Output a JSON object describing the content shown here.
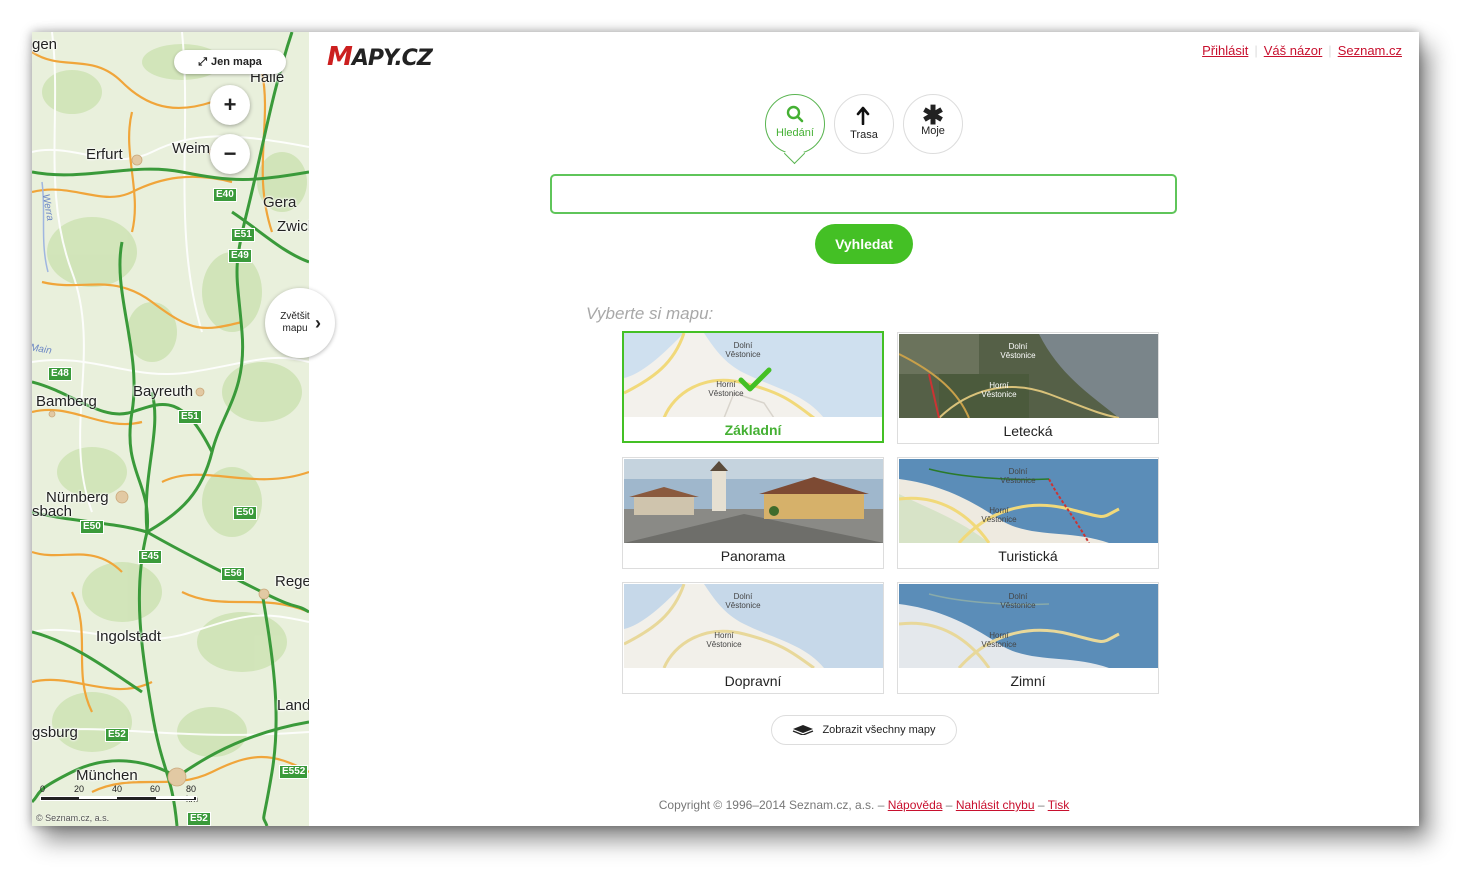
{
  "map": {
    "only_map_label": "Jen mapa",
    "zoom_in": "+",
    "zoom_out": "−",
    "expand_label_line1": "Zvětšit",
    "expand_label_line2": "mapu",
    "cities": [
      "gen",
      "Halle",
      "Erfurt",
      "Weim",
      "Gera",
      "Zwick",
      "Bamberg",
      "Bayreuth",
      "Nürnberg",
      "sbach",
      "Rege",
      "Ingolstadt",
      "Land",
      "gsburg",
      "München"
    ],
    "roads": [
      "E40",
      "E51",
      "E49",
      "E48",
      "E51",
      "E50",
      "E50",
      "E45",
      "E56",
      "E52",
      "E552",
      "E52"
    ],
    "rivers": [
      "Werra",
      "Main"
    ],
    "scale_ticks": [
      "0",
      "20",
      "40",
      "60",
      "80 km"
    ],
    "copyright": "© Seznam.cz, a.s."
  },
  "header": {
    "logo_m": "M",
    "logo_rest": "APY.CZ",
    "links": [
      "Přihlásit",
      "Váš názor",
      "Seznam.cz"
    ]
  },
  "modes": [
    {
      "label": "Hledání",
      "icon": "search-icon"
    },
    {
      "label": "Trasa",
      "icon": "arrow-up-icon"
    },
    {
      "label": "Moje",
      "icon": "star-icon"
    }
  ],
  "search": {
    "value": "",
    "button": "Vyhledat"
  },
  "choose_label": "Vyberte si mapu:",
  "map_types": [
    {
      "name": "Základní",
      "selected": true,
      "thumb_labels": [
        "Dolní Věstonice",
        "Horní Věstonice"
      ]
    },
    {
      "name": "Letecká",
      "selected": false,
      "thumb_labels": [
        "Dolní Věstonice",
        "Horní Věstonice"
      ]
    },
    {
      "name": "Panorama",
      "selected": false,
      "thumb_labels": []
    },
    {
      "name": "Turistická",
      "selected": false,
      "thumb_labels": [
        "Dolní Věstonice",
        "Horní Věstonice"
      ]
    },
    {
      "name": "Dopravní",
      "selected": false,
      "thumb_labels": [
        "Dolní Věstonice",
        "Horní Věstonice"
      ]
    },
    {
      "name": "Zimní",
      "selected": false,
      "thumb_labels": [
        "Dolní Věstonice",
        "Horní Věstonice"
      ]
    }
  ],
  "all_maps_label": "Zobrazit všechny mapy",
  "footer": {
    "copyright": "Copyright © 1996–2014 Seznam.cz, a.s. –",
    "links": [
      "Nápověda",
      "Nahlásit chybu",
      "Tisk"
    ],
    "sep": "–"
  },
  "colors": {
    "accent_green": "#44c025",
    "link_red": "#c8102e",
    "road_green": "#3a9a3a",
    "road_orange": "#f0a53a"
  }
}
